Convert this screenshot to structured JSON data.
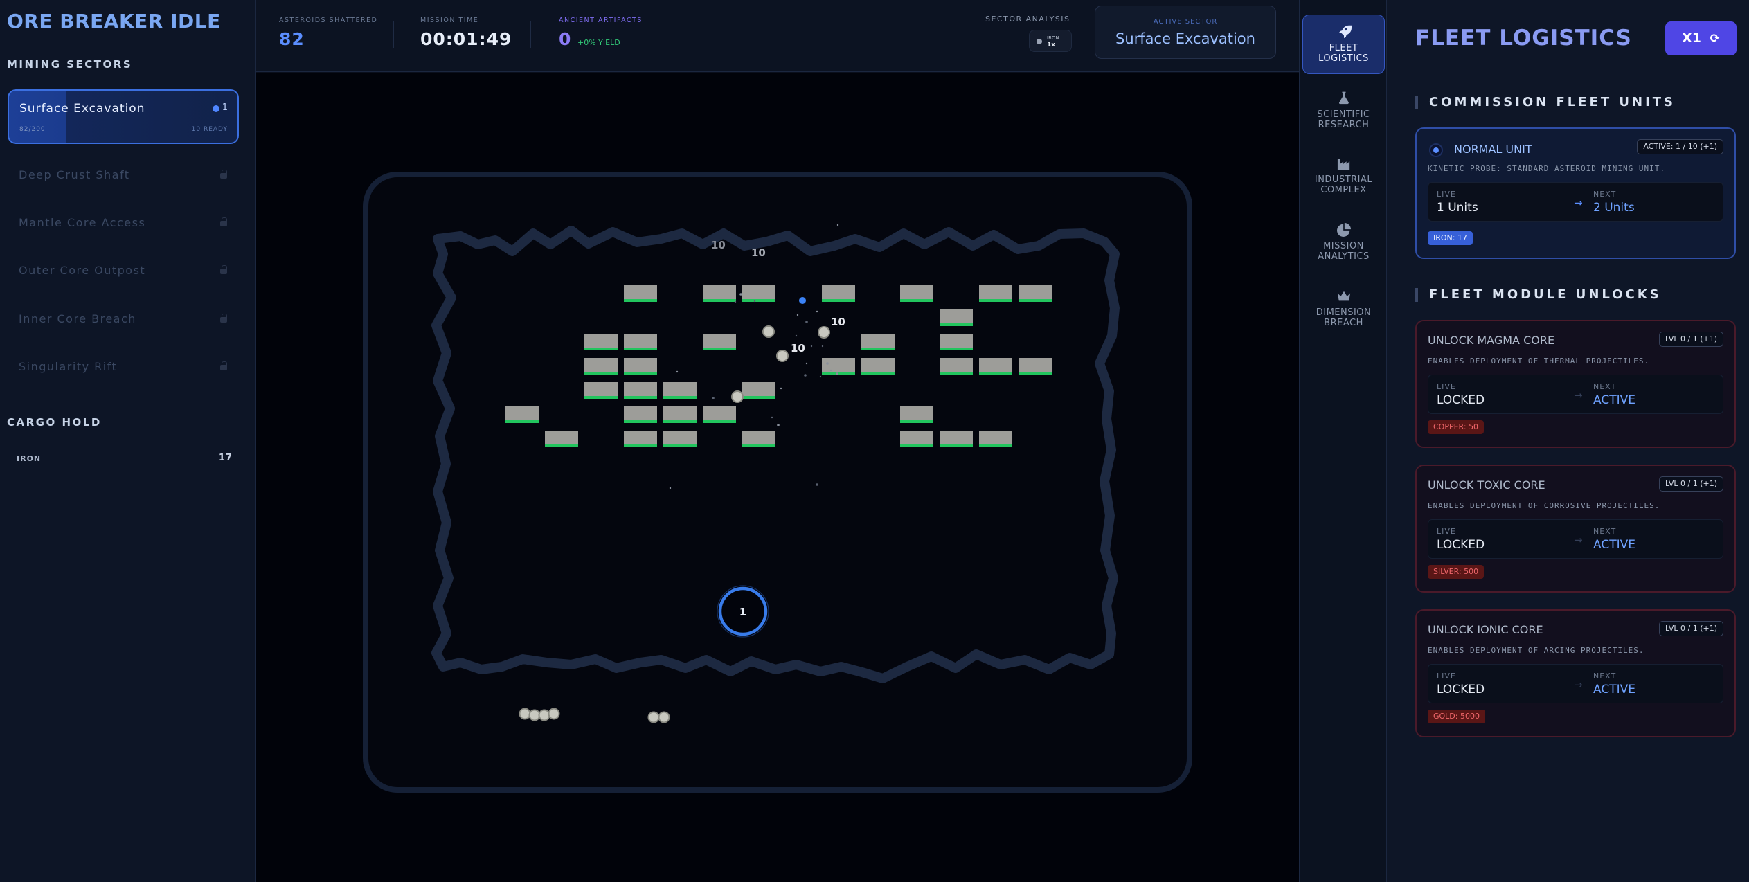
{
  "app": {
    "title": "ORE BREAKER IDLE"
  },
  "sidebar": {
    "sectors_title": "MINING SECTORS",
    "active_sector": {
      "name": "Surface Excavation",
      "count": "1",
      "progress": "82/200",
      "ready": "10 READY"
    },
    "locked_sectors": [
      "Deep Crust Shaft",
      "Mantle Core Access",
      "Outer Core Outpost",
      "Inner Core Breach",
      "Singularity Rift"
    ],
    "cargo_title": "CARGO HOLD",
    "cargo": [
      {
        "name": "IRON",
        "value": "17"
      }
    ]
  },
  "topbar": {
    "asteroids_label": "ASTEROIDS SHATTERED",
    "asteroids_value": "82",
    "mission_label": "MISSION TIME",
    "mission_value": "00:01:49",
    "artifacts_label": "ANCIENT ARTIFACTS",
    "artifacts_value": "0",
    "artifacts_yield": "+0% YIELD",
    "sector_analysis_label": "SECTOR ANALYSIS",
    "sector_chip_ore": "IRON",
    "sector_chip_mult": "1x",
    "active_sector_label": "ACTIVE SECTOR",
    "active_sector_value": "Surface Excavation"
  },
  "game": {
    "damage_texts": [
      "10",
      "10",
      "10",
      "10"
    ],
    "paddle_label": "1"
  },
  "rail": {
    "items": [
      {
        "label1": "FLEET",
        "label2": "LOGISTICS",
        "icon": "rocket-icon"
      },
      {
        "label1": "SCIENTIFIC",
        "label2": "RESEARCH",
        "icon": "flask-icon"
      },
      {
        "label1": "INDUSTRIAL",
        "label2": "COMPLEX",
        "icon": "factory-icon"
      },
      {
        "label1": "MISSION",
        "label2": "ANALYTICS",
        "icon": "pie-chart-icon"
      },
      {
        "label1": "DIMENSION",
        "label2": "BREACH",
        "icon": "crown-icon"
      }
    ]
  },
  "panel": {
    "title": "FLEET LOGISTICS",
    "multiplier": "X1",
    "section1": "COMMISSION FLEET UNITS",
    "unit": {
      "name": "NORMAL UNIT",
      "badge": "ACTIVE: 1 / 10 (+1)",
      "desc": "KINETIC PROBE: STANDARD ASTEROID MINING UNIT.",
      "live_label": "LIVE",
      "live_value": "1 Units",
      "next_label": "NEXT",
      "next_value": "2 Units",
      "cost": "IRON: 17"
    },
    "section2": "FLEET MODULE UNLOCKS",
    "modules": [
      {
        "name": "UNLOCK MAGMA CORE",
        "badge": "LVL 0 / 1 (+1)",
        "desc": "ENABLES DEPLOYMENT OF THERMAL PROJECTILES.",
        "live_label": "LIVE",
        "live_value": "LOCKED",
        "next_label": "NEXT",
        "next_value": "ACTIVE",
        "cost": "COPPER: 50"
      },
      {
        "name": "UNLOCK TOXIC CORE",
        "badge": "LVL 0 / 1 (+1)",
        "desc": "ENABLES DEPLOYMENT OF CORROSIVE PROJECTILES.",
        "live_label": "LIVE",
        "live_value": "LOCKED",
        "next_label": "NEXT",
        "next_value": "ACTIVE",
        "cost": "SILVER: 500"
      },
      {
        "name": "UNLOCK IONIC CORE",
        "badge": "LVL 0 / 1 (+1)",
        "desc": "ENABLES DEPLOYMENT OF ARCING PROJECTILES.",
        "live_label": "LIVE",
        "live_value": "LOCKED",
        "next_label": "NEXT",
        "next_value": "ACTIVE",
        "cost": "GOLD: 5000"
      }
    ]
  },
  "colors": {
    "accent": "#4f46e5",
    "brick": "#9a9a9a",
    "brick_health": "#22c55e",
    "paddle_ring": "#3b82f6"
  }
}
